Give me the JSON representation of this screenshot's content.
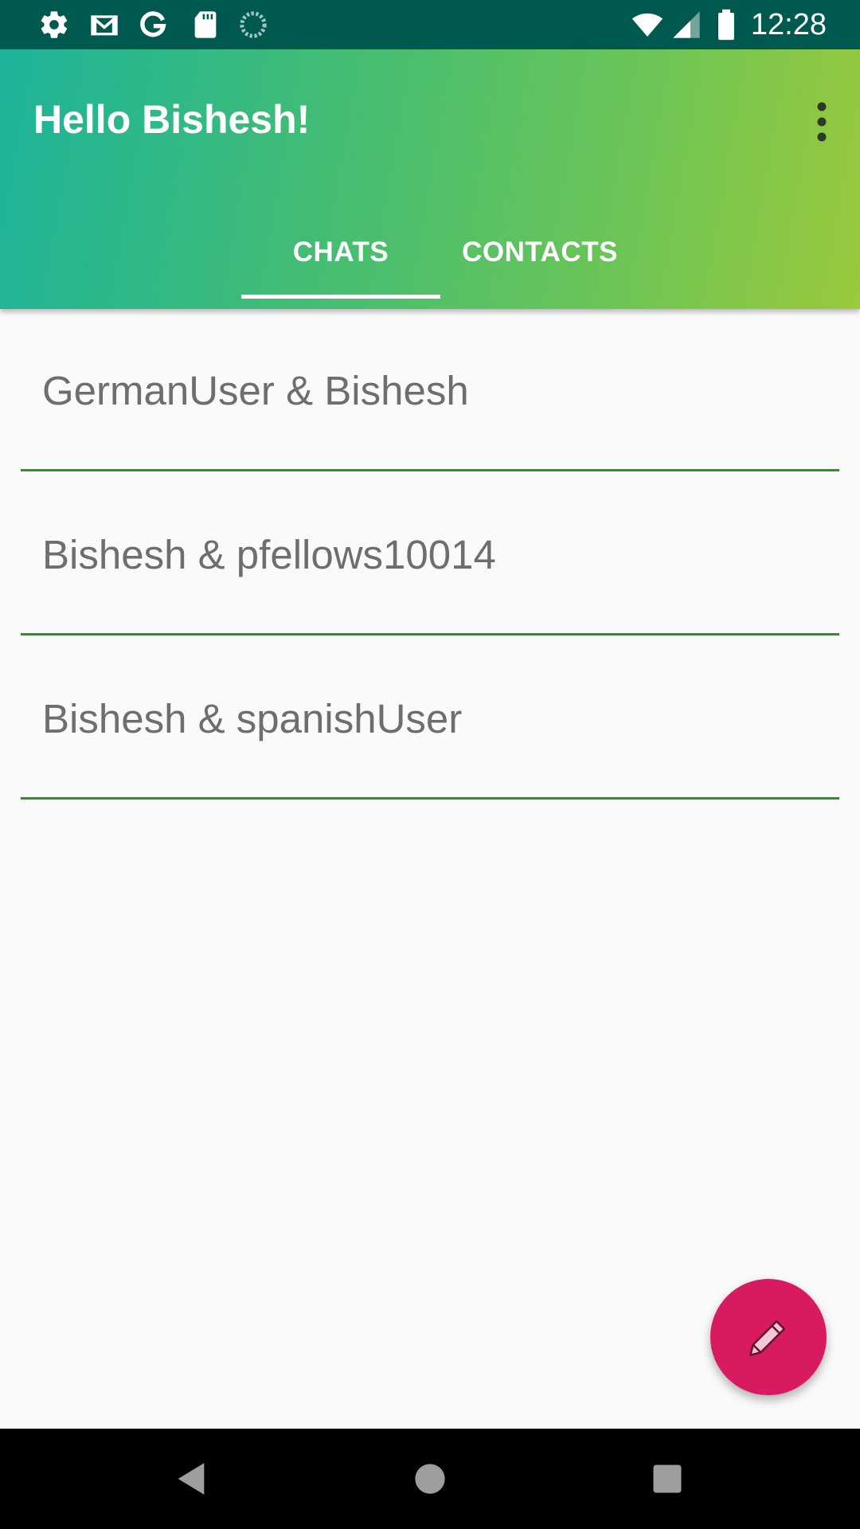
{
  "status_bar": {
    "time": "12:28",
    "left_icons": [
      "gear-icon",
      "gmail-icon",
      "google-icon",
      "sd-card-icon",
      "sync-icon"
    ],
    "right_icons": [
      "wifi-icon",
      "signal-icon",
      "battery-icon"
    ],
    "background": "#00594f"
  },
  "app_bar": {
    "title": "Hello Bishesh!",
    "menu_icon": "more-vert-icon",
    "gradient_start": "#1db39a",
    "gradient_end": "#9ac93b"
  },
  "tabs": [
    {
      "label": "CHATS",
      "selected": true
    },
    {
      "label": "CONTACTS",
      "selected": false
    }
  ],
  "chats": [
    {
      "title": "GermanUser & Bishesh"
    },
    {
      "title": "Bishesh & pfellows10014"
    },
    {
      "title": "Bishesh & spanishUser"
    }
  ],
  "colors": {
    "divider": "#1f9a1f",
    "fab": "#d81b60",
    "chat_text": "#6e6e6e"
  },
  "fab": {
    "icon": "pencil-icon"
  },
  "nav_bar": {
    "buttons": [
      "back-icon",
      "home-icon",
      "recents-icon"
    ]
  }
}
